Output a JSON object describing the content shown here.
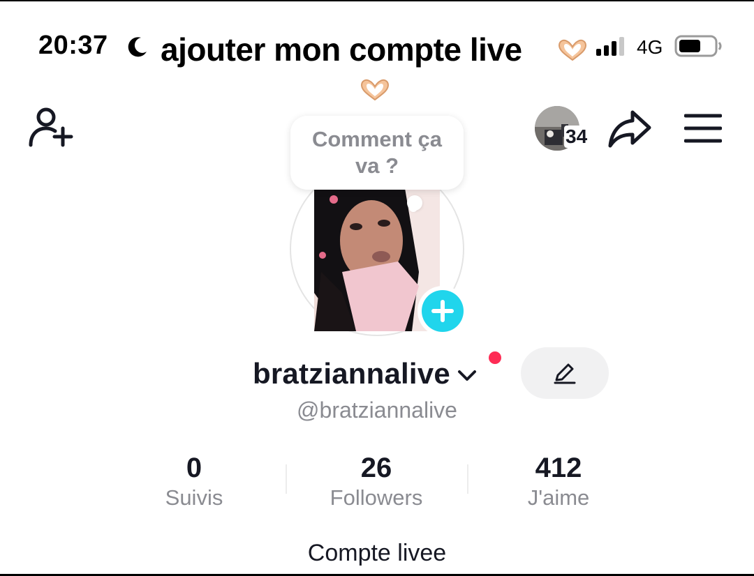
{
  "status_bar": {
    "time": "20:37",
    "network": "4G",
    "icons": [
      "moon-icon",
      "signal-icon",
      "battery-icon"
    ]
  },
  "overlay": {
    "caption": "ajouter mon compte live",
    "emoji": "heart-hands-emoji"
  },
  "top_bar": {
    "icons": [
      "add-user-icon",
      "share-icon",
      "menu-icon"
    ],
    "story_count": "34"
  },
  "profile": {
    "bubble_text": "Comment ça va ?",
    "username": "bratziannalive",
    "handle": "@bratziannalive",
    "bio": "Compte livee"
  },
  "stats": [
    {
      "value": "0",
      "label": "Suivis"
    },
    {
      "value": "26",
      "label": "Followers"
    },
    {
      "value": "412",
      "label": "J'aime"
    }
  ],
  "colors": {
    "text_primary": "#161823",
    "text_secondary": "#8a8b91",
    "accent_plus": "#20d5ec",
    "notification_dot": "#fe2c55",
    "edit_button_bg": "#f1f1f2"
  }
}
